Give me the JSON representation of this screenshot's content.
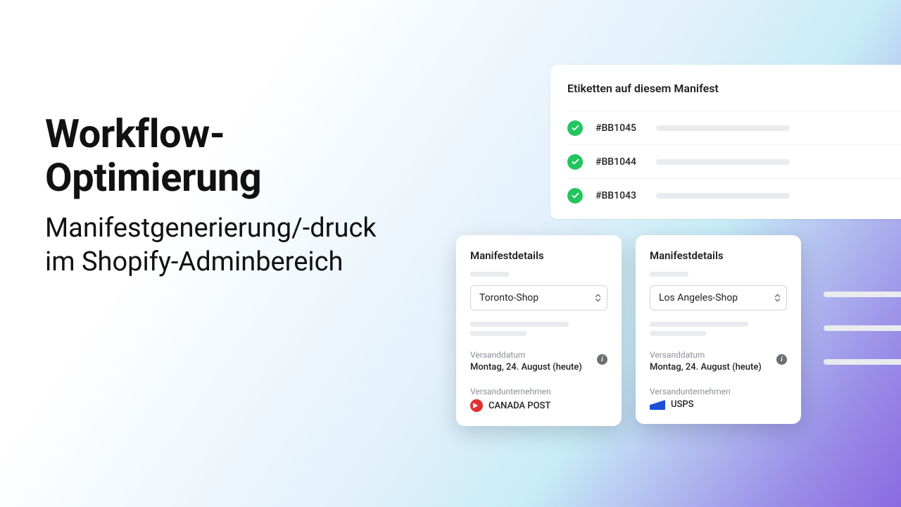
{
  "copy": {
    "headline": "Workflow-Optimierung",
    "subhead": "Manifestgenerierung/-druck im Shopify-Adminbereich"
  },
  "list": {
    "title": "Etiketten auf diesem Manifest",
    "rows": [
      {
        "id": "#BB1045"
      },
      {
        "id": "#BB1044"
      },
      {
        "id": "#BB1043"
      }
    ]
  },
  "details": {
    "left": {
      "title": "Manifestdetails",
      "select": "Toronto-Shop",
      "shipdate_label": "Versanddatum",
      "shipdate_value": "Montag, 24. August (heute)",
      "carrier_label": "Versandunternehmen",
      "carrier_name": "CANADA POST",
      "carrier_icon": "canada-post"
    },
    "right": {
      "title": "Manifestdetails",
      "select": "Los Angeles-Shop",
      "shipdate_label": "Versanddatum",
      "shipdate_value": "Montag, 24. August (heute)",
      "carrier_label": "Versandunternehmen",
      "carrier_name": "USPS",
      "carrier_icon": "usps"
    }
  }
}
